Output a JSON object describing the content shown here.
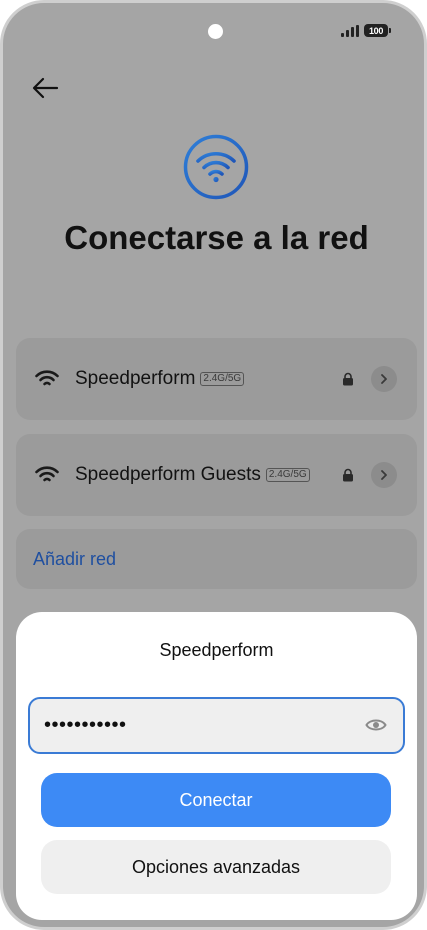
{
  "status_bar": {
    "battery": "100"
  },
  "page": {
    "title": "Conectarse a la red"
  },
  "networks": [
    {
      "name": "Speedperform",
      "band": "2.4G/5G"
    },
    {
      "name": "Speedperform Guests",
      "band": "2.4G/5G"
    }
  ],
  "add_network": {
    "label": "Añadir red"
  },
  "dialog": {
    "title": "Speedperform",
    "password_value": "•••••••••••",
    "connect_label": "Conectar",
    "advanced_label": "Opciones avanzadas"
  },
  "colors": {
    "accent": "#3d8af5",
    "link": "#1f4fa0",
    "input_border": "#3a7bd5"
  },
  "icons": [
    "back-arrow-icon",
    "wifi-icon",
    "lock-icon",
    "chevron-right-icon",
    "eye-icon",
    "signal-icon",
    "battery-icon"
  ]
}
